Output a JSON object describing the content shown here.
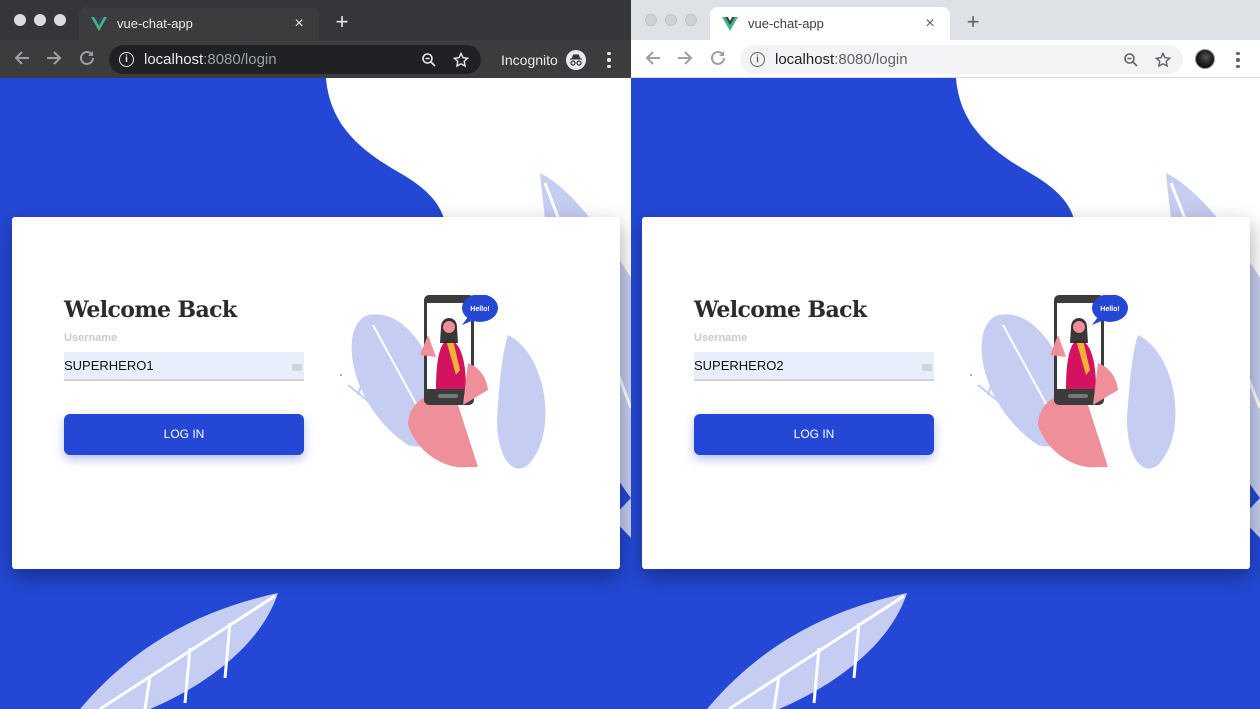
{
  "windows": [
    {
      "tab": {
        "title": "vue-chat-app",
        "close": "×"
      },
      "new_tab": "+",
      "address": {
        "host": "localhost",
        "path": ":8080/login"
      },
      "incognito_label": "Incognito",
      "page": {
        "heading": "Welcome Back",
        "username_label": "Username",
        "username_value": "SUPERHERO1",
        "login_button": "LOG IN",
        "bubble_text": "Hello!"
      }
    },
    {
      "tab": {
        "title": "vue-chat-app",
        "close": "×"
      },
      "new_tab": "+",
      "address": {
        "host": "localhost",
        "path": ":8080/login"
      },
      "page": {
        "heading": "Welcome Back",
        "username_label": "Username",
        "username_value": "SUPERHERO2",
        "login_button": "LOG IN",
        "bubble_text": "Hello!"
      }
    }
  ],
  "icons": [
    "vue-logo-icon",
    "close-icon",
    "plus-icon",
    "back-arrow-icon",
    "forward-arrow-icon",
    "reload-icon",
    "info-icon",
    "zoom-icon",
    "star-icon",
    "incognito-icon",
    "avatar-icon",
    "menu-dots-icon",
    "mail-icon"
  ],
  "colors": {
    "brand_blue": "#2448d5",
    "vue_green": "#41b883",
    "leaf": "#c6cdf3"
  }
}
